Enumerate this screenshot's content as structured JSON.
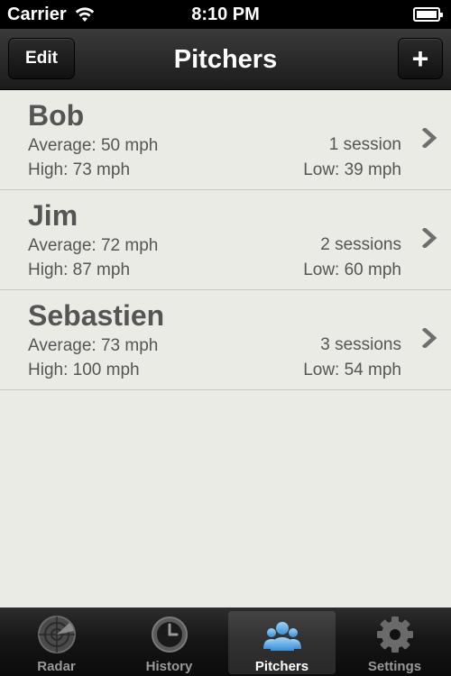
{
  "status_bar": {
    "carrier": "Carrier",
    "time": "8:10 PM"
  },
  "nav_bar": {
    "title": "Pitchers",
    "edit_label": "Edit",
    "add_label": "+"
  },
  "pitchers": [
    {
      "name": "Bob",
      "average": "Average: 50 mph",
      "high": "High: 73 mph",
      "sessions": "1 session",
      "low": "Low: 39 mph"
    },
    {
      "name": "Jim",
      "average": "Average: 72 mph",
      "high": "High: 87 mph",
      "sessions": "2 sessions",
      "low": "Low: 60 mph"
    },
    {
      "name": "Sebastien",
      "average": "Average: 73 mph",
      "high": "High: 100 mph",
      "sessions": "3 sessions",
      "low": "Low: 54 mph"
    }
  ],
  "tab_bar": {
    "tabs": [
      {
        "label": "Radar",
        "icon": "radar-icon",
        "active": false
      },
      {
        "label": "History",
        "icon": "clock-icon",
        "active": false
      },
      {
        "label": "Pitchers",
        "icon": "people-icon",
        "active": true
      },
      {
        "label": "Settings",
        "icon": "gear-icon",
        "active": false
      }
    ]
  },
  "colors": {
    "list_background": "#ebebe6",
    "active_tab_icon": "#5aa9e6"
  }
}
